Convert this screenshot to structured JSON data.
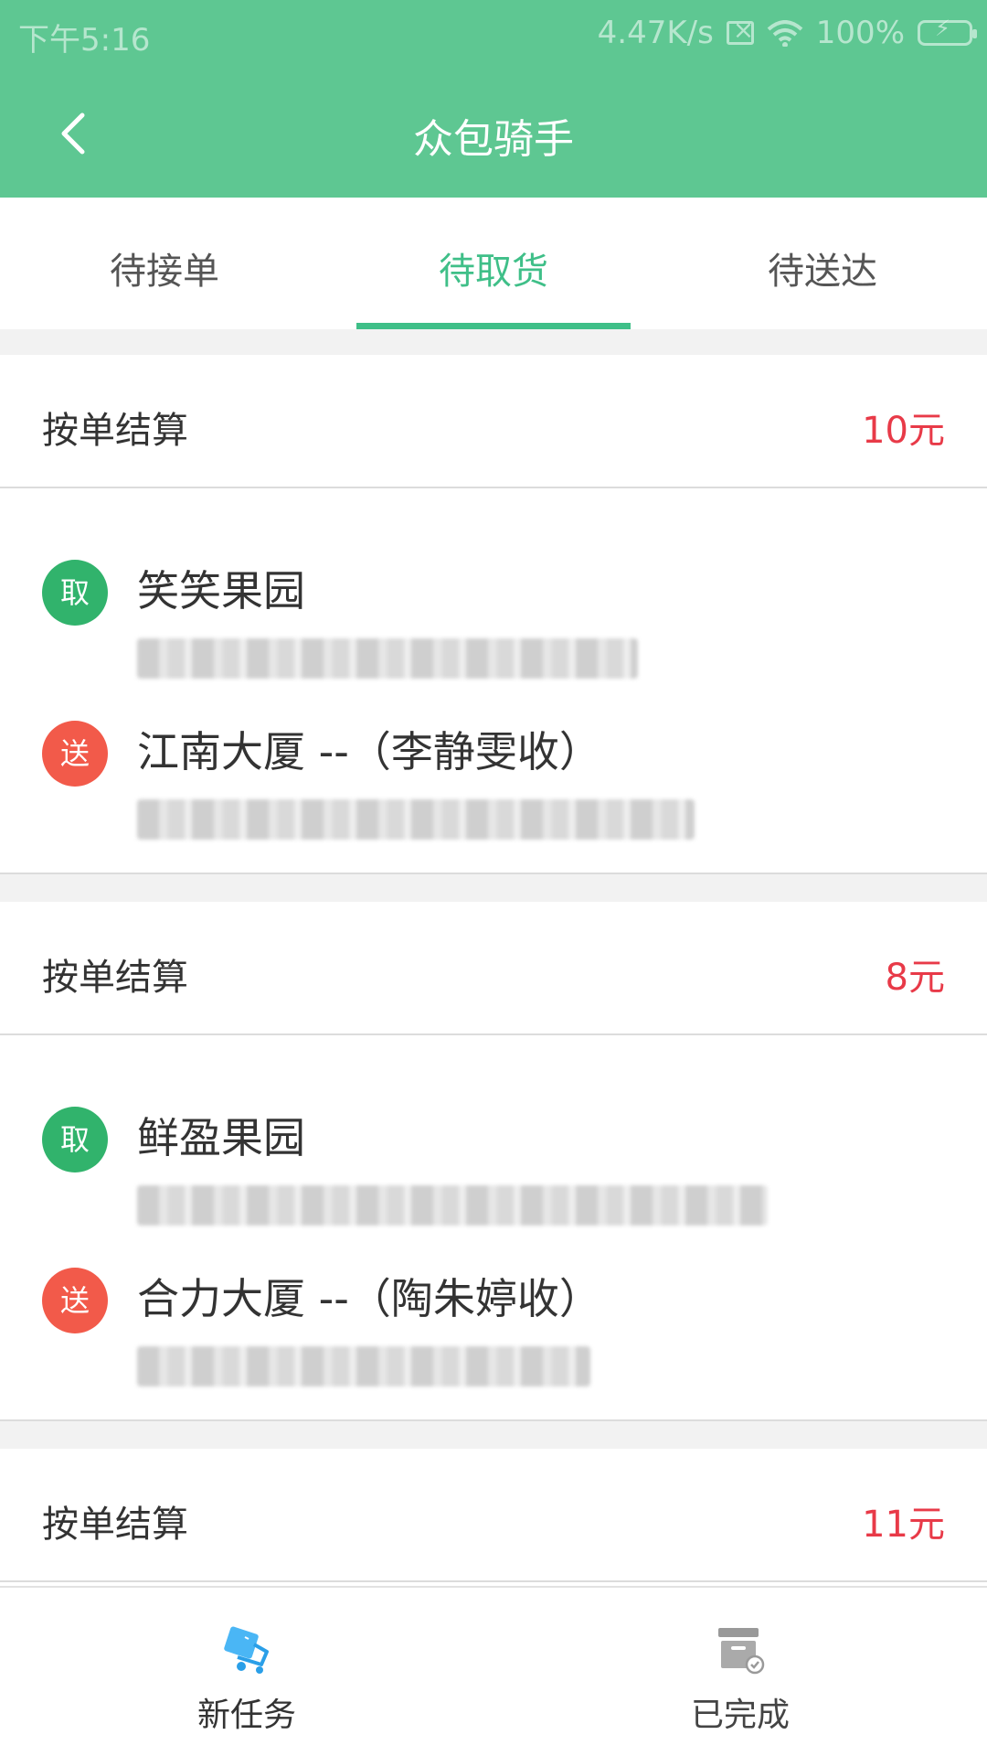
{
  "status_bar": {
    "time": "下午5:16",
    "network_speed": "4.47K/s",
    "battery": "100%"
  },
  "app_bar": {
    "title": "众包骑手"
  },
  "tabs": [
    {
      "label": "待接单",
      "active": false
    },
    {
      "label": "待取货",
      "active": true
    },
    {
      "label": "待送达",
      "active": false
    }
  ],
  "orders": [
    {
      "settlement_label": "按单结算",
      "price": "10元",
      "pickup": {
        "badge": "取",
        "name": "笑笑果园",
        "address": ""
      },
      "delivery": {
        "badge": "送",
        "name": "江南大厦 --（李静雯收）",
        "address": ""
      }
    },
    {
      "settlement_label": "按单结算",
      "price": "8元",
      "pickup": {
        "badge": "取",
        "name": "鲜盈果园",
        "address": ""
      },
      "delivery": {
        "badge": "送",
        "name": "合力大厦 --（陶朱婷收）",
        "address": ""
      }
    },
    {
      "settlement_label": "按单结算",
      "price": "11元"
    }
  ],
  "bottom_nav": [
    {
      "label": "新任务",
      "icon": "delivery-cart-icon",
      "active": true
    },
    {
      "label": "已完成",
      "icon": "archive-box-icon",
      "active": false
    }
  ],
  "colors": {
    "primary": "#5ec792",
    "accent": "#3fbf88",
    "price": "#e83a48",
    "pickup_badge": "#31b36c",
    "deliver_badge": "#f25a4a"
  }
}
